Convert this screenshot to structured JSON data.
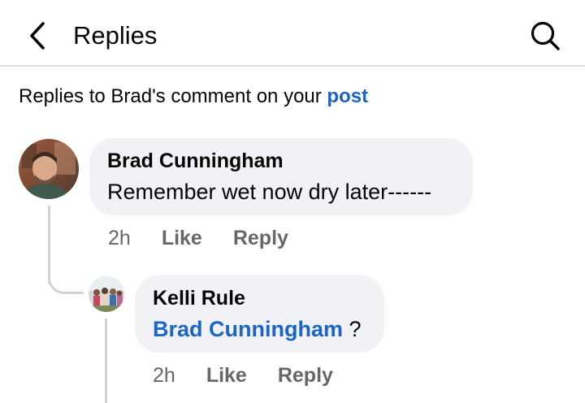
{
  "header": {
    "title": "Replies",
    "back_icon": "chevron-left-icon",
    "search_icon": "search-icon"
  },
  "context": {
    "prefix": "Replies to Brad's comment on your ",
    "link": "post"
  },
  "comments": [
    {
      "author": "Brad Cunningham",
      "text": "Remember wet now dry later------",
      "time": "2h",
      "like_label": "Like",
      "reply_label": "Reply"
    },
    {
      "author": "Kelli Rule",
      "mention": "Brad Cunningham",
      "text": " ?",
      "time": "2h",
      "like_label": "Like",
      "reply_label": "Reply"
    }
  ],
  "colors": {
    "link": "#1b65c9",
    "bubble": "#f0f2f5",
    "meta": "#65676b",
    "divider": "#dadde1"
  }
}
